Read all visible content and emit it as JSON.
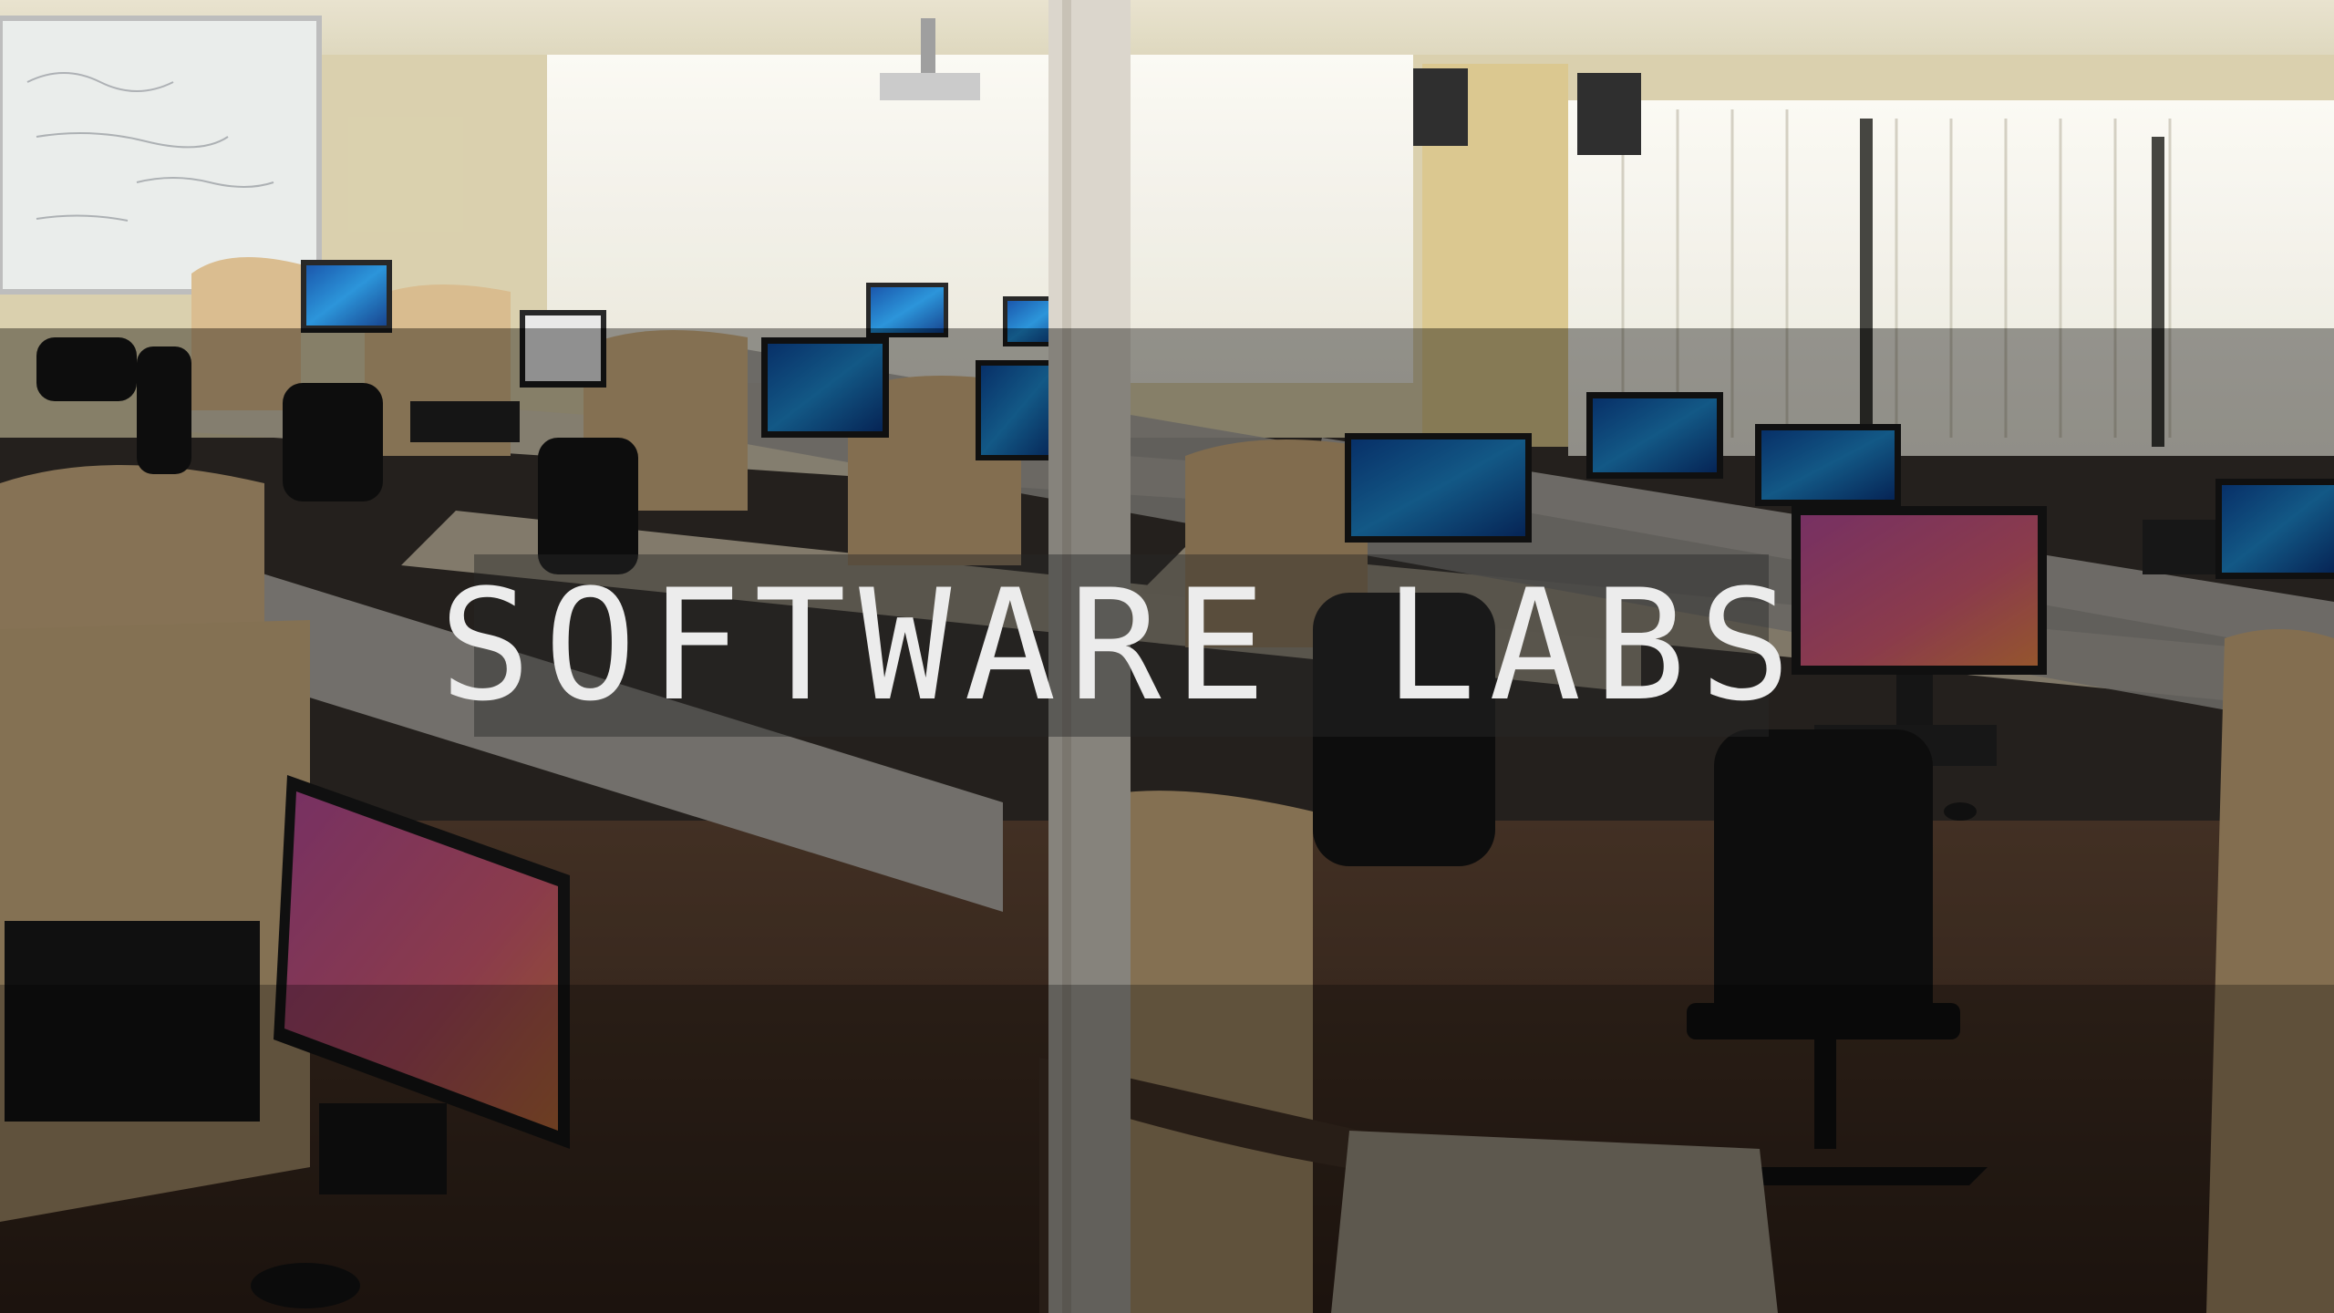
{
  "banner": {
    "title": "SOFTWARE LABS"
  },
  "palette": {
    "overlay_mid": "#000000",
    "title_color": "#ececec",
    "wall": "#d7cdb0",
    "desk": "#d6c7a8",
    "partition": "#b8b4ad",
    "monitor_windows": "#1f8fd8",
    "monitor_ubuntu": "#d35a8a"
  },
  "scene": {
    "description_icons": [
      "computer-monitor-icon",
      "office-chair-icon",
      "speaker-icon",
      "projector-icon"
    ]
  }
}
